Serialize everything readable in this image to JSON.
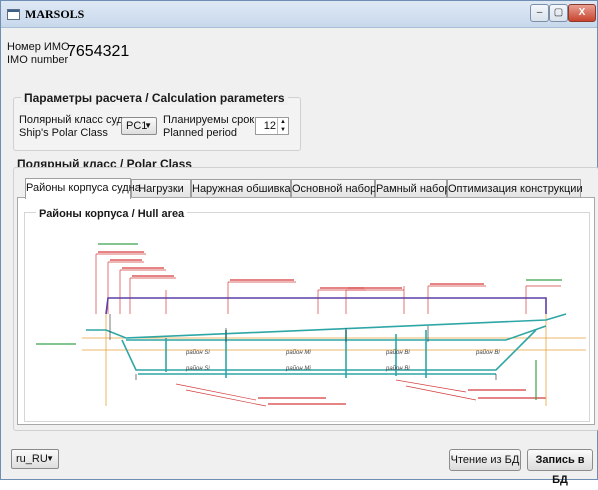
{
  "window": {
    "title": "MARSOLS",
    "min_label": "–",
    "max_label": "▢",
    "close_label": "X"
  },
  "imo": {
    "label_ru": "Номер ИМО",
    "label_en": "IMO number",
    "value": "7654321"
  },
  "calc": {
    "title": "Параметры расчета / Calculation parameters",
    "polar_label_ru": "Полярный класс судна",
    "polar_label_en": "Ship's Polar Class",
    "polar_value": "PC1",
    "period_label_ru": "Планируемы срок",
    "period_label_en": "Planned period",
    "period_value": "12"
  },
  "polar": {
    "title": "Полярный класс / Polar Class",
    "tabs": [
      {
        "label": "Районы корпуса судна"
      },
      {
        "label": "Нагрузки"
      },
      {
        "label": "Наружная обшивка"
      },
      {
        "label": "Основной набор"
      },
      {
        "label": "Рамный набор"
      },
      {
        "label": "Оптимизация конструкции"
      }
    ],
    "hull_title": "Районы корпуса / Hull area",
    "regions": {
      "bi": "район Bi",
      "mi": "район Mi",
      "si": "район Si"
    }
  },
  "footer": {
    "locale": "ru_RU",
    "read_label": "Чтение из БД",
    "write_label": "Запись в БД"
  },
  "colors": {
    "hull_line": "#2ea6a6",
    "deck_line": "#5b3fa8",
    "waterline": "#e9a23b",
    "annotation": "#d43b3b",
    "accent_green": "#3aa04a"
  }
}
